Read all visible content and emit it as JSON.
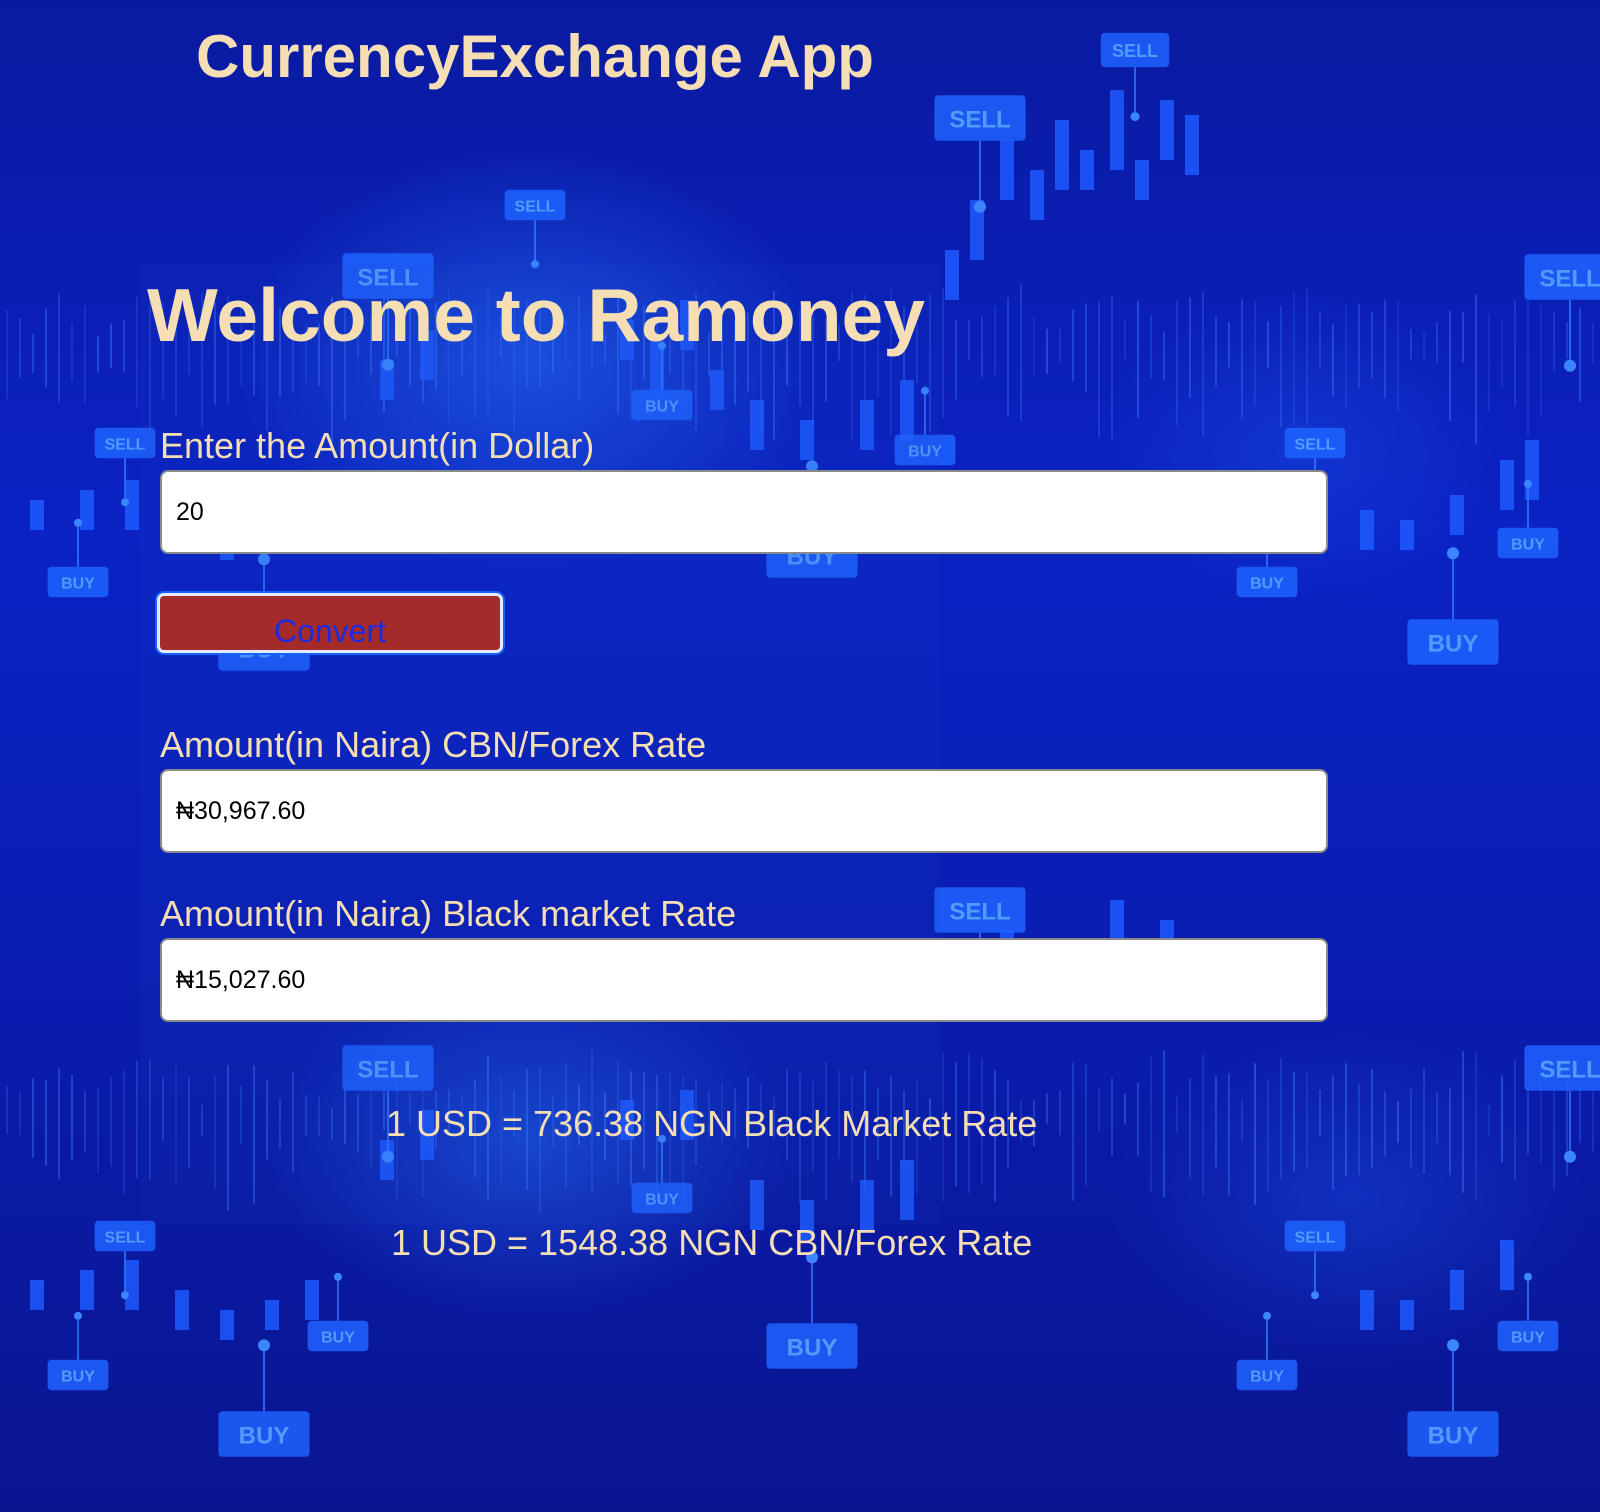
{
  "header": {
    "app_title": "CurrencyExchange App"
  },
  "main": {
    "welcome": "Welcome to Ramoney",
    "amount_input": {
      "label": "Enter the Amount(in Dollar)",
      "value": "20"
    },
    "convert_button": {
      "label": "Convert"
    },
    "cbn_output": {
      "label": "Amount(in Naira) CBN/Forex Rate",
      "value": "₦30,967.60"
    },
    "black_market_output": {
      "label": "Amount(in Naira) Black market Rate",
      "value": "₦15,027.60"
    },
    "rates": {
      "black_market": "1 USD = 736.38 NGN Black Market Rate",
      "cbn": "1 USD = 1548.38 NGN CBN/Forex Rate"
    }
  },
  "background": {
    "tags": [
      "SELL",
      "BUY"
    ]
  },
  "colors": {
    "title_text": "#f5deb3",
    "button_bg": "#a52a2a",
    "button_text": "#1d2be0",
    "background_dark": "#0a1aa0",
    "background_bright": "#1560ff"
  }
}
